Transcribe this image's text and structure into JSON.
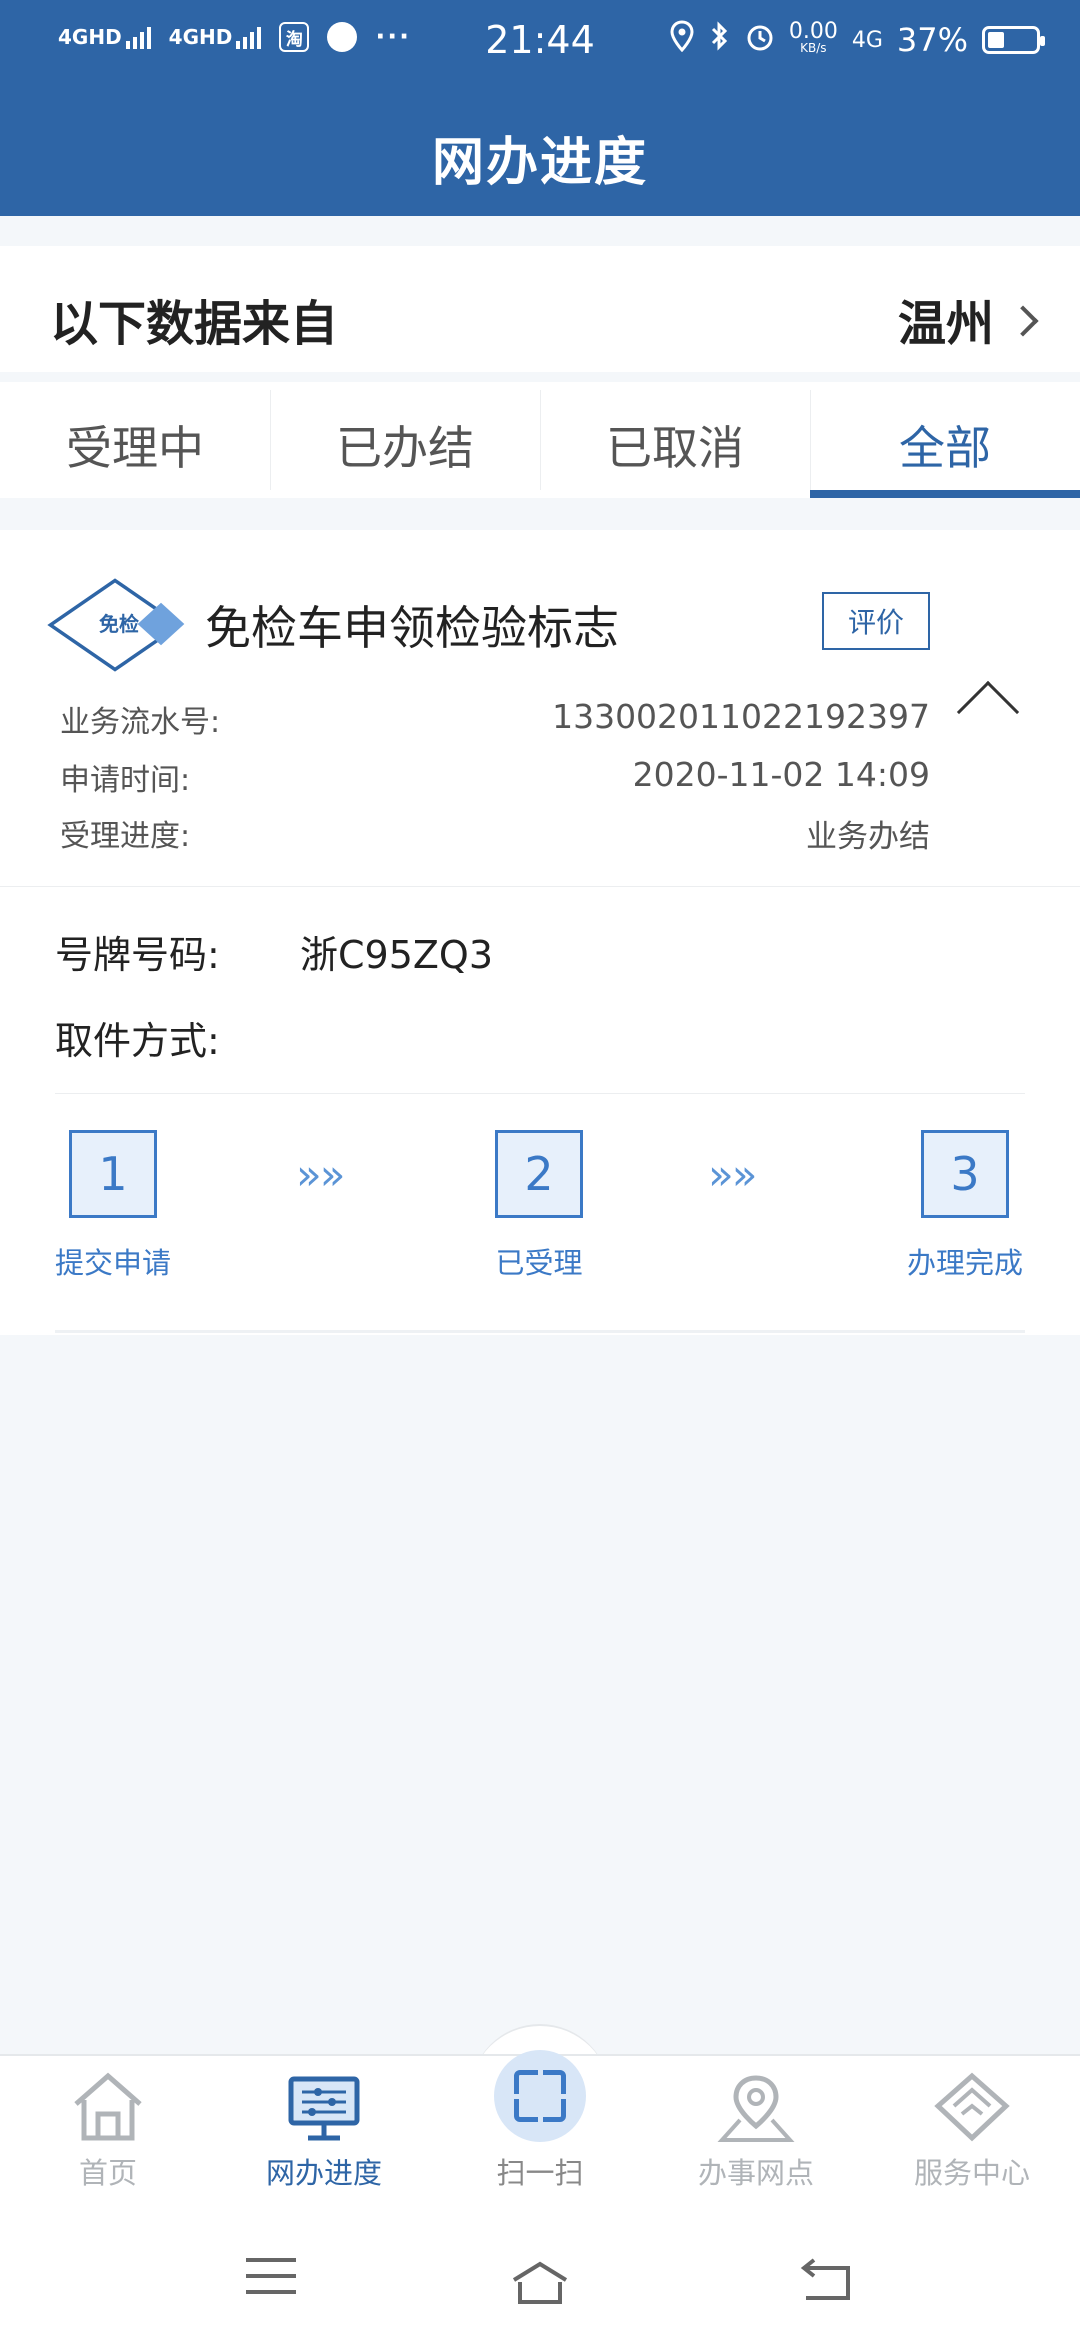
{
  "status_bar": {
    "network_1": "4GHD",
    "network_2": "4GHD",
    "taobao_icon": "淘",
    "more": "···",
    "time": "21:44",
    "speed_value": "0.00",
    "speed_unit": "KB/s",
    "network_type": "4G",
    "battery_percent": "37%"
  },
  "header": {
    "title": "网办进度"
  },
  "source": {
    "label": "以下数据来自",
    "city": "温州"
  },
  "tabs": [
    {
      "label": "受理中",
      "active": false
    },
    {
      "label": "已办结",
      "active": false
    },
    {
      "label": "已取消",
      "active": false
    },
    {
      "label": "全部",
      "active": true
    }
  ],
  "card": {
    "badge_text": "免检",
    "title": "免检车申领检验标志",
    "evaluate_label": "评价",
    "rows": [
      {
        "key": "业务流水号:",
        "value": "133002011022192397"
      },
      {
        "key": "申请时间:",
        "value": "2020-11-02 14:09"
      },
      {
        "key": "受理进度:",
        "value": "业务办结"
      }
    ],
    "plate_key": "号牌号码:",
    "plate_value": "浙C95ZQ3",
    "pickup_key": "取件方式:",
    "steps": [
      {
        "num": "1",
        "label": "提交申请"
      },
      {
        "num": "2",
        "label": "已受理"
      },
      {
        "num": "3",
        "label": "办理完成"
      }
    ],
    "arrow_glyph": "»»"
  },
  "bottom_nav": [
    {
      "label": "首页",
      "icon": "home-icon",
      "active": false
    },
    {
      "label": "网办进度",
      "icon": "monitor-icon",
      "active": true
    },
    {
      "label": "扫一扫",
      "icon": "scan-icon",
      "active": false
    },
    {
      "label": "办事网点",
      "icon": "location-pin-icon",
      "active": false
    },
    {
      "label": "服务中心",
      "icon": "handshake-icon",
      "active": false
    }
  ],
  "colors": {
    "brand": "#2e65a6",
    "accent": "#3b79c6",
    "background": "#f4f7fa",
    "inactive": "#b0b4b8"
  }
}
